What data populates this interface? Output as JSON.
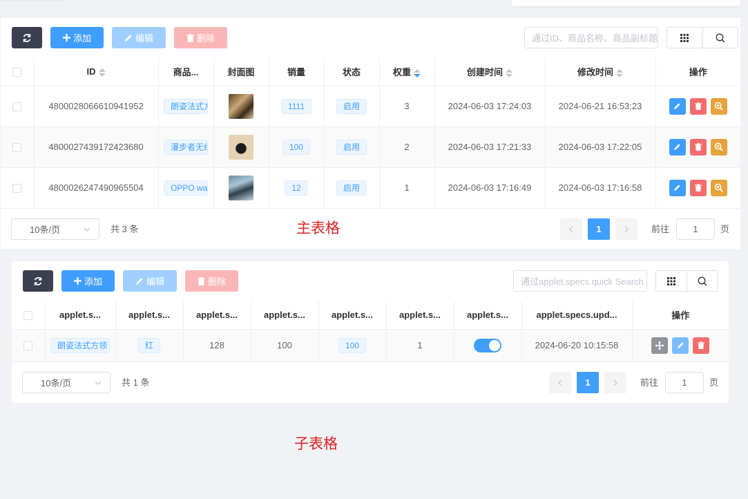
{
  "annotations": {
    "main_label": "主表格",
    "sub_label": "子表格"
  },
  "toolbar": {
    "add_label": "添加",
    "edit_label": "编辑",
    "delete_label": "删除"
  },
  "main": {
    "search_placeholder": "通过ID、商品名称、商品副标题",
    "columns": {
      "id": "ID",
      "product_name": "商品...",
      "cover": "封面图",
      "sales": "销量",
      "status": "状态",
      "weight": "权重",
      "created": "创建时间",
      "modified": "修改时间",
      "actions": "操作"
    },
    "rows": [
      {
        "id": "4800028066610941952",
        "name": "朗姿法式方领",
        "sales": "1111",
        "status": "启用",
        "weight": "3",
        "created": "2024-06-03 17:24:03",
        "modified": "2024-06-21 16:53:23"
      },
      {
        "id": "4800027439172423680",
        "name": "漫步者无线",
        "sales": "100",
        "status": "启用",
        "weight": "2",
        "created": "2024-06-03 17:21:33",
        "modified": "2024-06-03 17:22:05"
      },
      {
        "id": "4800026247490965504",
        "name": "OPPO watch",
        "sales": "12",
        "status": "启用",
        "weight": "1",
        "created": "2024-06-03 17:16:49",
        "modified": "2024-06-03 17:16:58"
      }
    ],
    "pager": {
      "size": "10条/页",
      "total": "共 3 条",
      "current_page": "1",
      "goto_label": "前往",
      "goto_value": "1",
      "page_label": "页"
    }
  },
  "sub": {
    "search_placeholder": "通过applet.specs.quick Search",
    "columns": [
      "applet.s...",
      "applet.s...",
      "applet.s...",
      "applet.s...",
      "applet.s...",
      "applet.s...",
      "applet.s...",
      "applet.specs.upd...",
      "操作"
    ],
    "rows": [
      {
        "product": "朗姿法式方领",
        "color": "红",
        "c3": "128",
        "c4": "100",
        "c5": "100",
        "c6": "1",
        "enabled": true,
        "updated": "2024-06-20 10:15:58"
      }
    ],
    "pager": {
      "size": "10条/页",
      "total": "共 1 条",
      "current_page": "1",
      "goto_label": "前往",
      "goto_value": "1",
      "page_label": "页"
    }
  },
  "colors": {
    "primary": "#409eff",
    "danger": "#f56c6c",
    "warning": "#e6a23c",
    "dark": "#3a4050",
    "annotation": "#e02020"
  }
}
